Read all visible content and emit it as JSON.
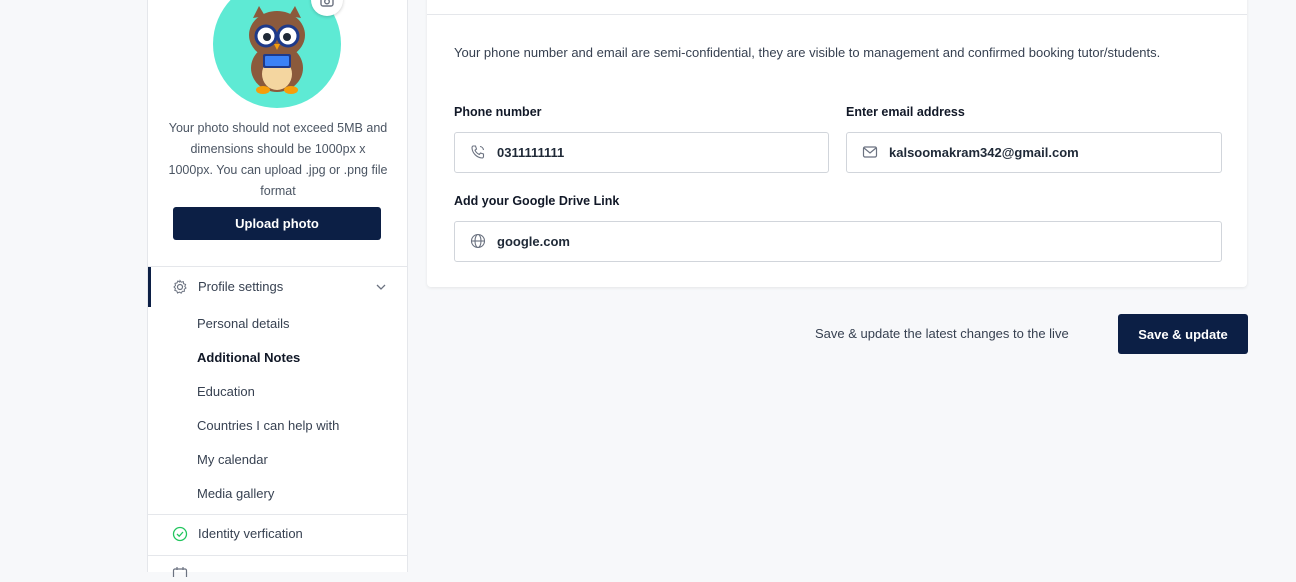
{
  "sidebar": {
    "photo_hint": "Your photo should not exceed 5MB and dimensions should be 1000px x 1000px. You can upload .jpg or .png file format",
    "upload_label": "Upload photo",
    "section_label": "Profile settings",
    "items": [
      {
        "label": "Personal details",
        "active": false
      },
      {
        "label": "Additional Notes",
        "active": true
      },
      {
        "label": "Education",
        "active": false
      },
      {
        "label": "Countries I can help with",
        "active": false
      },
      {
        "label": "My calendar",
        "active": false
      },
      {
        "label": "Media gallery",
        "active": false
      }
    ],
    "identity_label": "Identity verfication"
  },
  "form": {
    "intro": "Your phone number and email are semi-confidential, they are visible to management and confirmed booking tutor/students.",
    "phone_label": "Phone number",
    "phone_value": "0311111111",
    "email_label": "Enter email address",
    "email_value": "kalsoomakram342@gmail.com",
    "drive_label": "Add your Google Drive Link",
    "drive_value": "google.com"
  },
  "footer": {
    "save_hint": "Save & update the latest changes to the live",
    "save_label": "Save & update"
  },
  "colors": {
    "accent": "#0c1f45",
    "avatar_bg": "#5eead4",
    "success": "#22c55e"
  }
}
